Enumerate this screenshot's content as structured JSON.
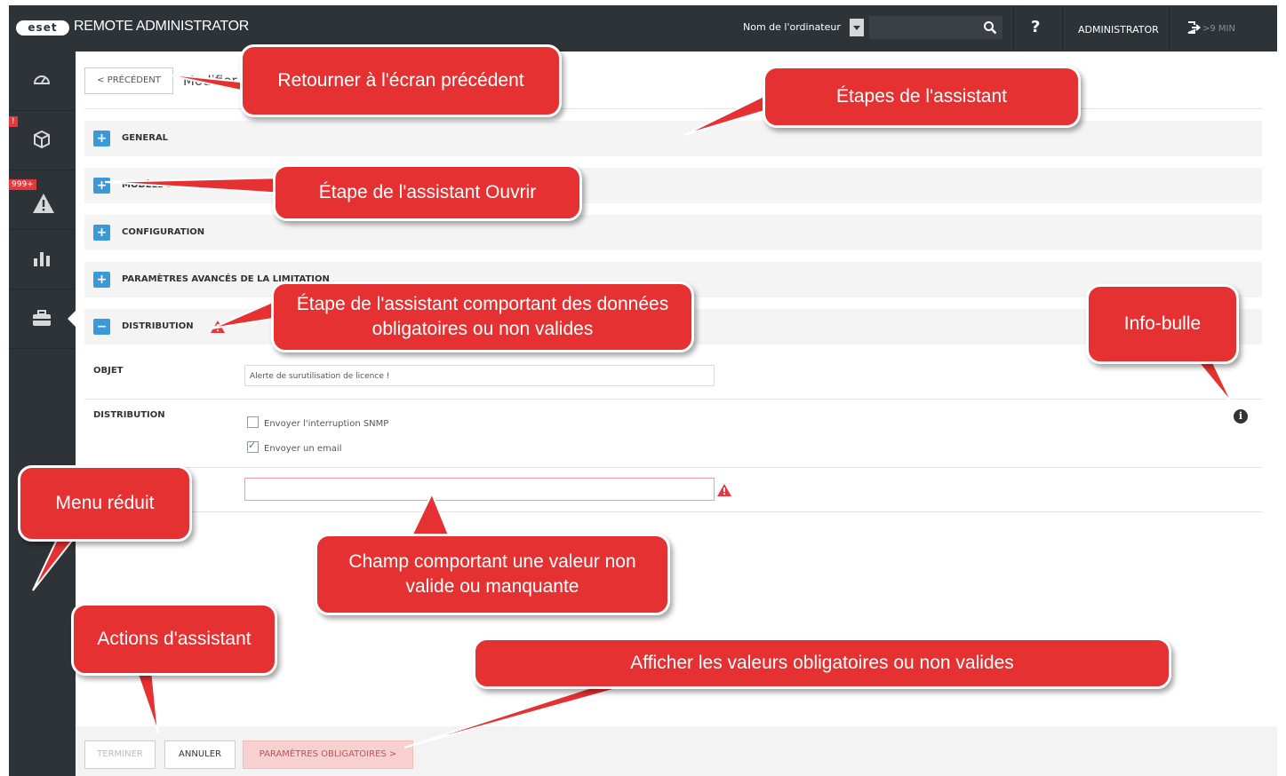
{
  "header": {
    "logo": "eset",
    "app_title": "REMOTE ADMINISTRATOR",
    "search_label": "Nom de l'ordinateur",
    "help": "?",
    "user": "ADMINISTRATOR",
    "session_time": ">9 MIN"
  },
  "sidebar": {
    "items": [
      {
        "icon": "dashboard-icon"
      },
      {
        "icon": "computers-icon",
        "badge": "!"
      },
      {
        "icon": "threats-icon",
        "badge": "999+"
      },
      {
        "icon": "reports-icon"
      },
      {
        "icon": "admin-icon",
        "active": true
      }
    ]
  },
  "page": {
    "back_label": "< PRÉCÉDENT",
    "title": "Modifier"
  },
  "sections": [
    {
      "label": "GENERAL",
      "state": "collapsed"
    },
    {
      "label": "MODÈLE DE NOTIFICATION",
      "state": "collapsed"
    },
    {
      "label": "CONFIGURATION",
      "state": "collapsed"
    },
    {
      "label": "PARAMÈTRES AVANCÉS DE LA LIMITATION",
      "state": "collapsed"
    },
    {
      "label": "DISTRIBUTION",
      "state": "expanded",
      "warning": true
    }
  ],
  "form": {
    "subject_label": "OBJET",
    "subject_value": "Alerte de surutilisation de licence !",
    "distribution_label": "DISTRIBUTION",
    "snmp_label": "Envoyer l'interruption SNMP",
    "snmp_checked": false,
    "email_label": "Envoyer un email",
    "email_checked": true,
    "email_value": ""
  },
  "footer": {
    "finish": "TERMINER",
    "cancel": "ANNULER",
    "required": "PARAMÈTRES OBLIGATOIRES >"
  },
  "callouts": {
    "back": "Retourner à l'écran précédent",
    "steps": "Étapes de l'assistant",
    "open_step": "Étape de l'assistant Ouvrir",
    "invalid_step": "Étape de l'assistant comportant des données obligatoires ou non valides",
    "tooltip": "Info-bulle",
    "collapsed_menu": "Menu réduit",
    "invalid_field": "Champ comportant une valeur non valide ou manquante",
    "wizard_actions": "Actions d'assistant",
    "show_required": "Afficher les valeurs obligatoires ou non valides"
  },
  "colors": {
    "topbar": "#2e3338",
    "accent": "#3a9ad9",
    "callout": "#e53131",
    "warning": "#e0393e"
  }
}
